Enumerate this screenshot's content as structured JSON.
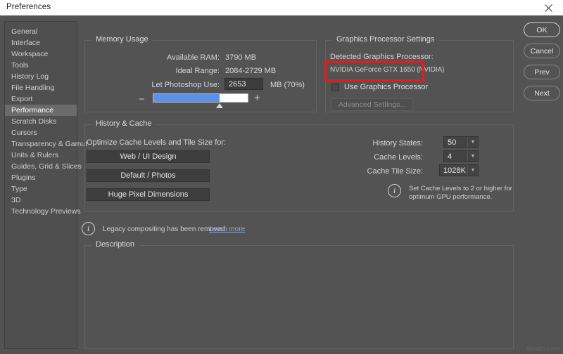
{
  "window": {
    "title": "Preferences",
    "close_icon": "close-icon"
  },
  "sidebar": {
    "items": [
      {
        "label": "General",
        "selected": false
      },
      {
        "label": "Interface",
        "selected": false
      },
      {
        "label": "Workspace",
        "selected": false
      },
      {
        "label": "Tools",
        "selected": false
      },
      {
        "label": "History Log",
        "selected": false
      },
      {
        "label": "File Handling",
        "selected": false
      },
      {
        "label": "Export",
        "selected": false
      },
      {
        "label": "Performance",
        "selected": true
      },
      {
        "label": "Scratch Disks",
        "selected": false
      },
      {
        "label": "Cursors",
        "selected": false
      },
      {
        "label": "Transparency & Gamut",
        "selected": false
      },
      {
        "label": "Units & Rulers",
        "selected": false
      },
      {
        "label": "Guides, Grid & Slices",
        "selected": false
      },
      {
        "label": "Plugins",
        "selected": false
      },
      {
        "label": "Type",
        "selected": false
      },
      {
        "label": "3D",
        "selected": false
      },
      {
        "label": "Technology Previews",
        "selected": false
      }
    ]
  },
  "buttons": {
    "ok": "OK",
    "cancel": "Cancel",
    "prev": "Prev",
    "next": "Next"
  },
  "memory": {
    "legend": "Memory Usage",
    "available_ram_label": "Available RAM:",
    "available_ram_value": "3790 MB",
    "ideal_range_label": "Ideal Range:",
    "ideal_range_value": "2084-2729 MB",
    "let_use_label": "Let Photoshop Use:",
    "let_use_value": "2653",
    "unit_percent": "MB (70%)",
    "slider_minus": "−",
    "slider_plus": "+",
    "slider_percent": 70,
    "slider_fill_color": "#5b91e8"
  },
  "gpu": {
    "legend": "Graphics Processor Settings",
    "detected_label": "Detected Graphics Processor:",
    "detected_model": "NVIDIA GeForce GTX 1650 (NVIDIA)",
    "use_gpu_label": "Use Graphics Processor",
    "use_gpu_checked": false,
    "advanced_settings_label": "Advanced Settings...",
    "highlight_color": "#e81b1b"
  },
  "history": {
    "legend": "History & Cache",
    "optimize_label": "Optimize Cache Levels and Tile Size for:",
    "preset_buttons": [
      "Web / UI Design",
      "Default / Photos",
      "Huge Pixel Dimensions"
    ],
    "fields": [
      {
        "label": "History States:",
        "value": "50"
      },
      {
        "label": "Cache Levels:",
        "value": "4"
      },
      {
        "label": "Cache Tile Size:",
        "value": "1028K"
      }
    ],
    "info_icon": "info-icon",
    "info_text": "Set Cache Levels to 2 or higher for\noptimum GPU performance."
  },
  "legacy": {
    "icon": "info-icon",
    "text": "Legacy compositing has been removed",
    "link_label": "Learn more"
  },
  "description": {
    "legend": "Description",
    "body": ""
  },
  "watermark": "wsxdn.com"
}
